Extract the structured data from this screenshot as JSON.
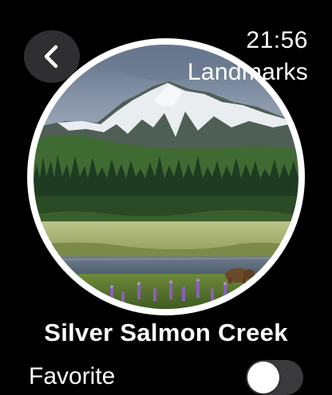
{
  "status": {
    "time": "21:56"
  },
  "header": {
    "title": "Landmarks",
    "back_icon": "chevron-left-icon"
  },
  "landmark": {
    "name": "Silver Salmon Creek"
  },
  "favorite": {
    "label": "Favorite",
    "on": false
  },
  "colors": {
    "background": "#000000",
    "back_button_bg": "#2f2f31",
    "toggle_off_bg": "#3a3a3c",
    "ring": "#ffffff"
  }
}
